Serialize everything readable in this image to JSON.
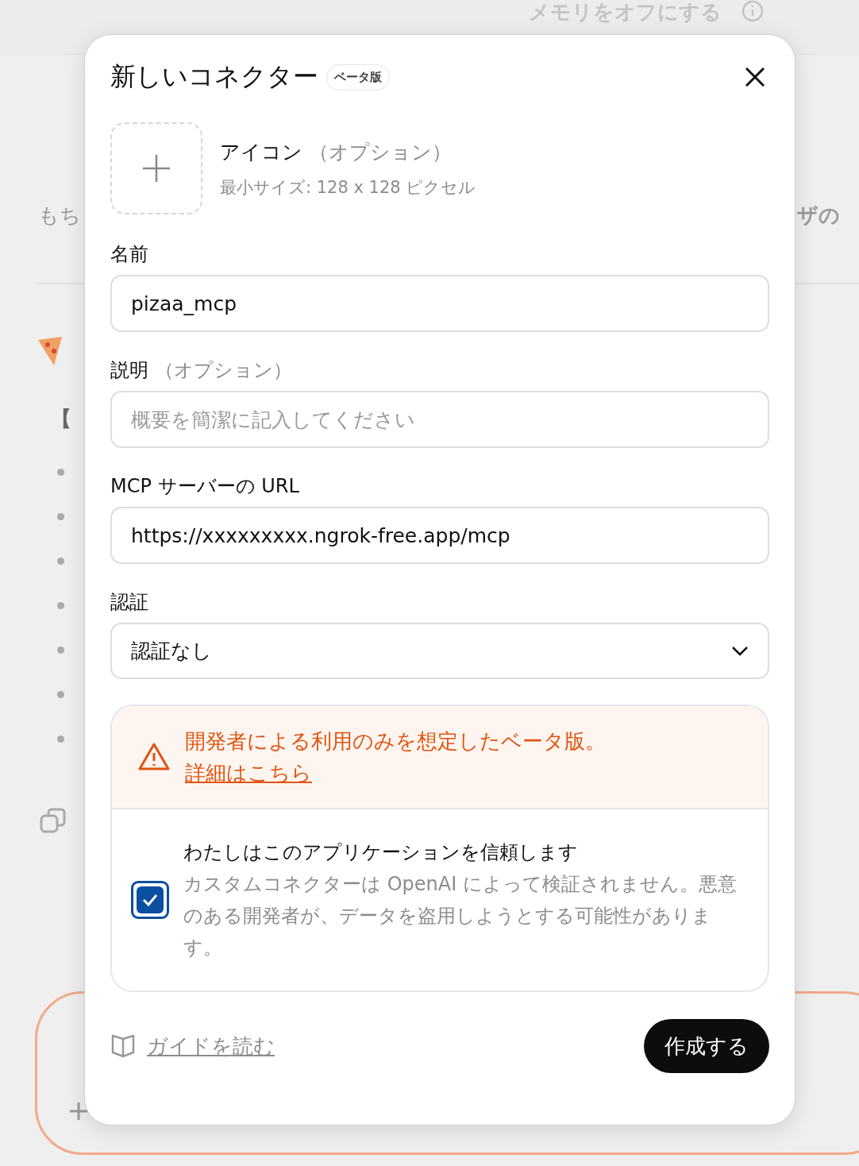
{
  "background": {
    "top_link": "メモリをオフにする",
    "left_heading": "もち",
    "left_line": "【",
    "right_heading": "ザの"
  },
  "dialog": {
    "title": "新しいコネクター",
    "badge": "ベータ版",
    "icon_upload": {
      "label": "アイコン",
      "optional": "（オプション）",
      "hint": "最小サイズ: 128 x 128 ピクセル"
    },
    "fields": [
      {
        "kind": "text",
        "label": "名前",
        "value": "pizaa_mcp"
      },
      {
        "kind": "text",
        "label": "説明",
        "optional": "（オプション）",
        "placeholder": "概要を簡潔に記入してください"
      },
      {
        "kind": "text",
        "label": "MCP サーバーの URL",
        "value": "https://xxxxxxxxx.ngrok-free.app/mcp"
      },
      {
        "kind": "select",
        "label": "認証",
        "value": "認証なし"
      }
    ],
    "warning": {
      "text": "開発者による利用のみを想定したベータ版。",
      "link": "詳細はこちら"
    },
    "trust": {
      "checked": true,
      "title": "わたしはこのアプリケーションを信頼します",
      "description": "カスタムコネクターは OpenAI によって検証されません。悪意のある開発者が、データを盗用しようとする可能性があります。"
    },
    "guide_link": "ガイドを読む",
    "create_button": "作成する"
  }
}
